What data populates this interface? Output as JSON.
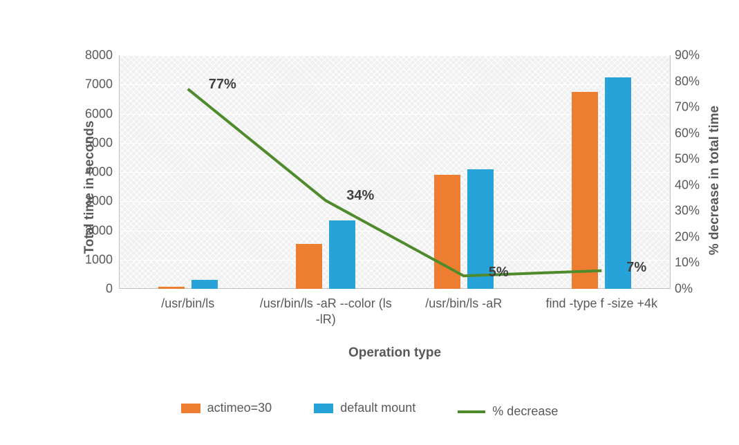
{
  "chart_data": {
    "type": "bar",
    "categories": [
      "/usr/bin/ls",
      "/usr/bin/ls -aR --color (ls -lR)",
      "/usr/bin/ls -aR",
      "find -type f -size +4k"
    ],
    "series": [
      {
        "name": "actimeo=30",
        "values": [
          70,
          1550,
          3900,
          6750
        ],
        "color": "#ed7d31"
      },
      {
        "name": "default mount",
        "values": [
          300,
          2350,
          4100,
          7250
        ],
        "color": "#26a3d9"
      }
    ],
    "line_series": {
      "name": "% decrease",
      "values": [
        77,
        34,
        5,
        7
      ],
      "labels": [
        "77%",
        "34%",
        "5%",
        "7%"
      ],
      "color": "#4f8b2c"
    },
    "xlabel": "Operation type",
    "ylabel": "Total time in seconds",
    "y2label": "% decrease in total time",
    "ylim": [
      0,
      8000
    ],
    "y_ticks": [
      0,
      1000,
      2000,
      3000,
      4000,
      5000,
      6000,
      7000,
      8000
    ],
    "y2lim": [
      0,
      90
    ],
    "y2_ticks": [
      0,
      10,
      20,
      30,
      40,
      50,
      60,
      70,
      80,
      90
    ],
    "y2_tick_labels": [
      "0%",
      "10%",
      "20%",
      "30%",
      "40%",
      "50%",
      "60%",
      "70%",
      "80%",
      "90%"
    ]
  }
}
